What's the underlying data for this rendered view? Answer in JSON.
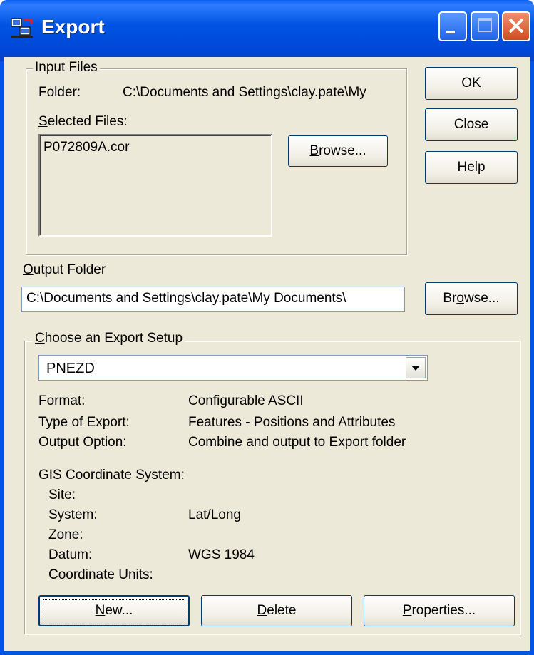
{
  "window": {
    "title": "Export"
  },
  "input_files": {
    "group_label": "Input Files",
    "folder_label": "Folder:",
    "folder_value": "C:\\Documents and Settings\\clay.pate\\My",
    "selected_label": "Selected Files:",
    "selected_label_u": "S",
    "selected_label_rest": "elected Files:",
    "files": [
      "P072809A.cor"
    ],
    "browse_u": "B",
    "browse_rest": "rowse..."
  },
  "buttons": {
    "ok": "OK",
    "close": "Close",
    "help_u": "H",
    "help_rest": "elp"
  },
  "output_folder": {
    "label_u": "O",
    "label_rest": "utput Folder",
    "value": "C:\\Documents and Settings\\clay.pate\\My Documents\\",
    "browse_pre": "Br",
    "browse_u": "o",
    "browse_rest": "wse..."
  },
  "export_setup": {
    "group_label_u": "C",
    "group_label_rest": "hoose an Export Setup",
    "selected": "PNEZD",
    "details": [
      {
        "label": "Format:",
        "value": "Configurable ASCII"
      },
      {
        "label": "Type of Export:",
        "value": "Features - Positions and Attributes"
      },
      {
        "label": "Output Option:",
        "value": "Combine and output to Export folder"
      }
    ],
    "gis_title": "GIS Coordinate System:",
    "gis": [
      {
        "label": "Site:",
        "value": ""
      },
      {
        "label": "System:",
        "value": "Lat/Long"
      },
      {
        "label": "Zone:",
        "value": ""
      },
      {
        "label": "Datum:",
        "value": "WGS 1984"
      },
      {
        "label": "Coordinate Units:",
        "value": ""
      }
    ],
    "new_u": "N",
    "new_rest": "ew...",
    "delete_u": "D",
    "delete_rest": "elete",
    "properties_u": "P",
    "properties_rest": "roperties..."
  }
}
